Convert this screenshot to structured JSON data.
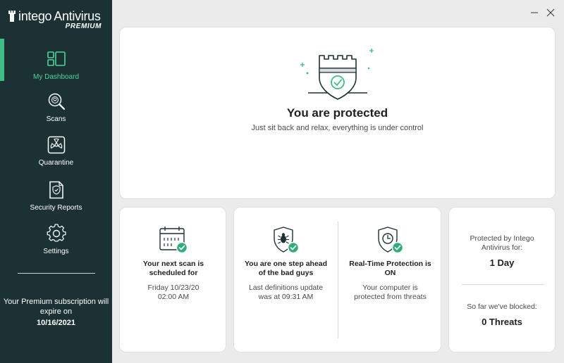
{
  "brand": {
    "name_light": "intego",
    "name_regular": "Antivirus",
    "tier": "PREMIUM"
  },
  "sidebar": {
    "items": [
      {
        "label": "My Dashboard",
        "icon": "dashboard-icon",
        "active": true
      },
      {
        "label": "Scans",
        "icon": "scan-magnifier-icon",
        "active": false
      },
      {
        "label": "Quarantine",
        "icon": "quarantine-icon",
        "active": false
      },
      {
        "label": "Security Reports",
        "icon": "report-icon",
        "active": false
      },
      {
        "label": "Settings",
        "icon": "gear-icon",
        "active": false
      }
    ],
    "subscription_note": "Your Premium subscription will expire on",
    "subscription_date": "10/16/2021"
  },
  "window": {
    "minimize": "minimize-icon",
    "close": "close-icon"
  },
  "status": {
    "title": "You are protected",
    "subtitle": "Just sit back and relax, everything is under control"
  },
  "scan_card": {
    "title": "Your next scan is scheduled for",
    "detail": "Friday 10/23/20 02:00 AM"
  },
  "definitions_card": {
    "title": "You are one step ahead of the bad guys",
    "detail": "Last definitions update was at 09:31 AM"
  },
  "realtime_card": {
    "title": "Real-Time Protection is ON",
    "detail": "Your computer is protected from threats"
  },
  "stats_card": {
    "protected_label": "Protected by Intego Antivirus for:",
    "protected_value": "1 Day",
    "blocked_label": "So far we've blocked:",
    "blocked_value": "0 Threats"
  },
  "colors": {
    "sidebar_bg": "#1c3133",
    "accent_green": "#3ebd85",
    "check_green": "#2fae79",
    "page_bg": "#ebebeb"
  }
}
